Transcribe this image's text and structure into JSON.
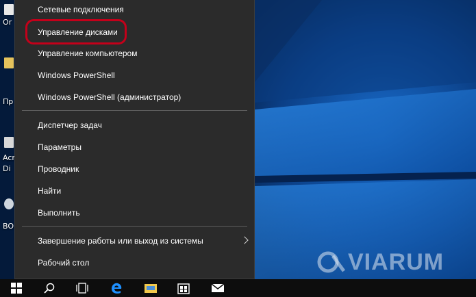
{
  "menu": {
    "items": [
      {
        "label": "Сетевые подключения"
      },
      {
        "label": "Управление дисками"
      },
      {
        "label": "Управление компьютером"
      },
      {
        "label": "Windows PowerShell"
      },
      {
        "label": "Windows PowerShell (администратор)"
      },
      {
        "label": "Диспетчер задач"
      },
      {
        "label": "Параметры"
      },
      {
        "label": "Проводник"
      },
      {
        "label": "Найти"
      },
      {
        "label": "Выполнить"
      },
      {
        "label": "Завершение работы или выход из системы"
      },
      {
        "label": "Рабочий стол"
      }
    ],
    "highlighted_item": "Управление дисками"
  },
  "desktop": {
    "icon_labels": [
      "Or",
      "Пр",
      "Acr",
      "Di",
      "BO"
    ]
  },
  "watermark": {
    "text": "VIARUM"
  },
  "taskbar": {
    "buttons": [
      {
        "icon": "windows-start-icon"
      },
      {
        "icon": "search-icon"
      },
      {
        "icon": "task-view-icon"
      },
      {
        "icon": "edge-icon"
      },
      {
        "icon": "file-explorer-icon"
      },
      {
        "icon": "store-icon"
      },
      {
        "icon": "mail-icon"
      }
    ]
  },
  "colors": {
    "menu_bg": "#2b2b2b",
    "highlight_ring": "#c4001a",
    "taskbar_bg": "#0d0d0d",
    "desktop_blue": "#0a4fa8"
  }
}
